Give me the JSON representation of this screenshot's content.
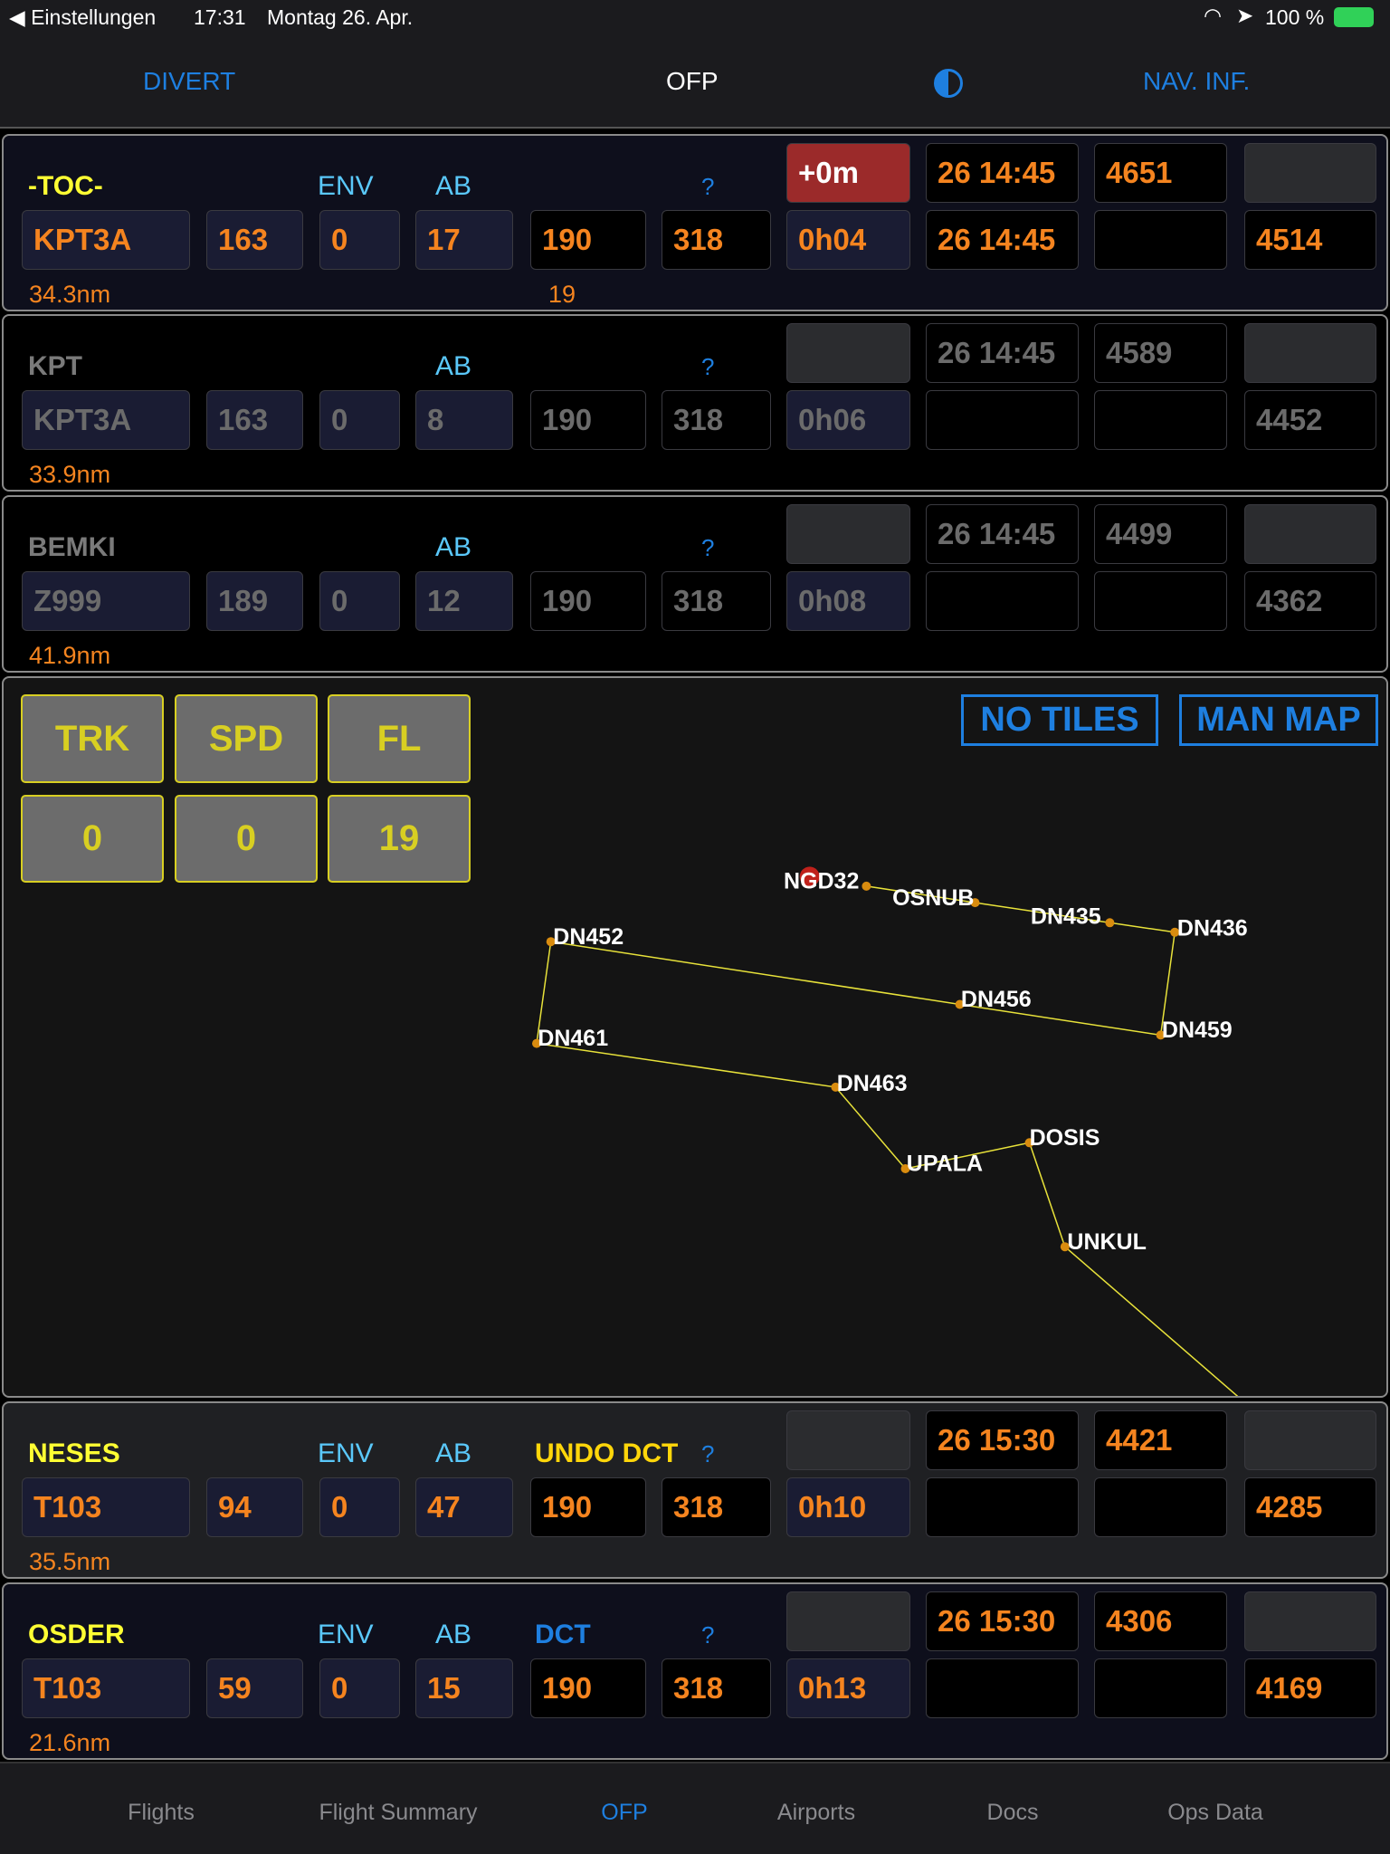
{
  "status_bar": {
    "back_label": "Einstellungen",
    "time": "17:31",
    "date": "Montag 26. Apr.",
    "battery": "100 %"
  },
  "nav": {
    "left": "DIVERT",
    "title": "OFP",
    "right": "NAV. INF.",
    "contrast_icon": "half-circle-icon"
  },
  "colors": {
    "accent": "#1e7fe0",
    "value": "#f5841f",
    "waypoint": "#ffff33",
    "label_blue": "#5ac8fa",
    "dim": "#6b6b6b",
    "alert": "#9b2a2a"
  },
  "rows": [
    {
      "name": "-TOC-",
      "env": "ENV",
      "ab": "AB",
      "dct": "",
      "q": "?",
      "state": "active",
      "bg": "#0e0f1c",
      "top": [
        {
          "v": "+0m",
          "t": "red"
        },
        {
          "v": "26 14:45",
          "t": "black"
        },
        {
          "v": "4651",
          "t": "black"
        },
        {
          "v": "",
          "t": "gray"
        }
      ],
      "bottom": [
        {
          "v": "KPT3A",
          "t": "navy"
        },
        {
          "v": "163",
          "t": "navy"
        },
        {
          "v": "0",
          "t": "navy"
        },
        {
          "v": "17",
          "t": "navy"
        },
        {
          "v": "190",
          "t": "black"
        },
        {
          "v": "318",
          "t": "black"
        },
        {
          "v": "0h04",
          "t": "navy"
        },
        {
          "v": "26 14:45",
          "t": "black"
        },
        {
          "v": "",
          "t": "black"
        },
        {
          "v": "4514",
          "t": "black"
        }
      ],
      "dist": "34.3nm",
      "extra": "19"
    },
    {
      "name": "KPT",
      "env": "",
      "ab": "AB",
      "dct": "",
      "q": "?",
      "state": "dim",
      "bg": "#000000",
      "top": [
        {
          "v": "",
          "t": "gray"
        },
        {
          "v": "26 14:45",
          "t": "black"
        },
        {
          "v": "4589",
          "t": "black"
        },
        {
          "v": "",
          "t": "gray"
        }
      ],
      "bottom": [
        {
          "v": "KPT3A",
          "t": "navy"
        },
        {
          "v": "163",
          "t": "navy"
        },
        {
          "v": "0",
          "t": "navy"
        },
        {
          "v": "8",
          "t": "navy"
        },
        {
          "v": "190",
          "t": "black"
        },
        {
          "v": "318",
          "t": "black"
        },
        {
          "v": "0h06",
          "t": "navy"
        },
        {
          "v": "",
          "t": "black"
        },
        {
          "v": "",
          "t": "black"
        },
        {
          "v": "4452",
          "t": "black"
        }
      ],
      "dist": "33.9nm",
      "extra": ""
    },
    {
      "name": "BEMKI",
      "env": "",
      "ab": "AB",
      "dct": "",
      "q": "?",
      "state": "dim",
      "bg": "#000000",
      "top": [
        {
          "v": "",
          "t": "gray"
        },
        {
          "v": "26 14:45",
          "t": "black"
        },
        {
          "v": "4499",
          "t": "black"
        },
        {
          "v": "",
          "t": "gray"
        }
      ],
      "bottom": [
        {
          "v": "Z999",
          "t": "navy"
        },
        {
          "v": "189",
          "t": "navy"
        },
        {
          "v": "0",
          "t": "navy"
        },
        {
          "v": "12",
          "t": "navy"
        },
        {
          "v": "190",
          "t": "black"
        },
        {
          "v": "318",
          "t": "black"
        },
        {
          "v": "0h08",
          "t": "navy"
        },
        {
          "v": "",
          "t": "black"
        },
        {
          "v": "",
          "t": "black"
        },
        {
          "v": "4362",
          "t": "black"
        }
      ],
      "dist": "41.9nm",
      "extra": ""
    },
    {
      "name": "NESES",
      "env": "ENV",
      "ab": "AB",
      "dct": "UNDO DCT",
      "dct_color": "#ffd60a",
      "q": "?",
      "state": "active",
      "bg": "#1f2023",
      "top": [
        {
          "v": "",
          "t": "gray"
        },
        {
          "v": "26 15:30",
          "t": "black"
        },
        {
          "v": "4421",
          "t": "black"
        },
        {
          "v": "",
          "t": "gray"
        }
      ],
      "bottom": [
        {
          "v": "T103",
          "t": "navy"
        },
        {
          "v": "94",
          "t": "navy"
        },
        {
          "v": "0",
          "t": "navy"
        },
        {
          "v": "47",
          "t": "navy"
        },
        {
          "v": "190",
          "t": "black"
        },
        {
          "v": "318",
          "t": "black"
        },
        {
          "v": "0h10",
          "t": "navy"
        },
        {
          "v": "",
          "t": "black"
        },
        {
          "v": "",
          "t": "black"
        },
        {
          "v": "4285",
          "t": "black"
        }
      ],
      "dist": "35.5nm",
      "extra": ""
    },
    {
      "name": "OSDER",
      "env": "ENV",
      "ab": "AB",
      "dct": "DCT",
      "dct_color": "#1e7fe0",
      "q": "?",
      "state": "active",
      "bg": "#0e0f1c",
      "top": [
        {
          "v": "",
          "t": "gray"
        },
        {
          "v": "26 15:30",
          "t": "black"
        },
        {
          "v": "4306",
          "t": "black"
        },
        {
          "v": "",
          "t": "gray"
        }
      ],
      "bottom": [
        {
          "v": "T103",
          "t": "navy"
        },
        {
          "v": "59",
          "t": "navy"
        },
        {
          "v": "0",
          "t": "navy"
        },
        {
          "v": "15",
          "t": "navy"
        },
        {
          "v": "190",
          "t": "black"
        },
        {
          "v": "318",
          "t": "black"
        },
        {
          "v": "0h13",
          "t": "navy"
        },
        {
          "v": "",
          "t": "black"
        },
        {
          "v": "",
          "t": "black"
        },
        {
          "v": "4169",
          "t": "black"
        }
      ],
      "dist": "21.6nm",
      "extra": ""
    }
  ],
  "map": {
    "headers": [
      "TRK",
      "SPD",
      "FL"
    ],
    "values": [
      "0",
      "0",
      "19"
    ],
    "no_tiles": "NO TILES",
    "man_map": "MAN MAP",
    "waypoints": [
      "NGD32",
      "OSNUB",
      "DN435",
      "DN436",
      "DN459",
      "DN456",
      "DN452",
      "DN461",
      "DN463",
      "UPALA",
      "DOSIS",
      "UNKUL"
    ]
  },
  "tabs": [
    {
      "label": "Flights"
    },
    {
      "label": "Flight Summary"
    },
    {
      "label": "OFP",
      "active": true
    },
    {
      "label": "Airports"
    },
    {
      "label": "Docs"
    },
    {
      "label": "Ops Data"
    }
  ]
}
